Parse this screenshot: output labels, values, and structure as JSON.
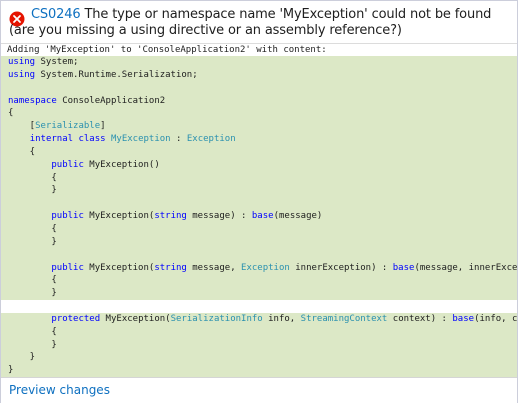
{
  "error": {
    "code": "CS0246",
    "message": " The type or namespace name 'MyException' could not be found (are you missing a using directive or an assembly reference?)"
  },
  "adding_text": "Adding 'MyException' to 'ConsoleApplication2' with content:",
  "code_lines": [
    {
      "highlight": true,
      "parts": [
        [
          "kw",
          "using"
        ],
        [
          "",
          "System;"
        ]
      ]
    },
    {
      "highlight": true,
      "parts": [
        [
          "kw",
          "using"
        ],
        [
          "",
          "System.Runtime.Serialization;"
        ]
      ]
    },
    {
      "highlight": true,
      "parts": []
    },
    {
      "highlight": true,
      "parts": [
        [
          "kw",
          "namespace"
        ],
        [
          "",
          "ConsoleApplication2"
        ]
      ]
    },
    {
      "highlight": true,
      "parts": [
        [
          "",
          "{"
        ]
      ]
    },
    {
      "highlight": true,
      "parts": [
        [
          "",
          "    ["
        ],
        [
          "ty",
          "Serializable"
        ],
        [
          "",
          "]"
        ]
      ]
    },
    {
      "highlight": true,
      "parts": [
        [
          "",
          "    "
        ],
        [
          "kw",
          "internal"
        ],
        [
          "",
          ""
        ],
        [
          "kw",
          "class"
        ],
        [
          "",
          ""
        ],
        [
          "ty",
          "MyException"
        ],
        [
          "",
          " : "
        ],
        [
          "ty",
          "Exception"
        ]
      ]
    },
    {
      "highlight": true,
      "parts": [
        [
          "",
          "    {"
        ]
      ]
    },
    {
      "highlight": true,
      "parts": [
        [
          "",
          "        "
        ],
        [
          "kw",
          "public"
        ],
        [
          "",
          "MyException()"
        ]
      ]
    },
    {
      "highlight": true,
      "parts": [
        [
          "",
          "        {"
        ]
      ]
    },
    {
      "highlight": true,
      "parts": [
        [
          "",
          "        }"
        ]
      ]
    },
    {
      "highlight": true,
      "parts": []
    },
    {
      "highlight": true,
      "parts": [
        [
          "",
          "        "
        ],
        [
          "kw",
          "public"
        ],
        [
          "",
          "MyException("
        ],
        [
          "kw",
          "string"
        ],
        [
          "",
          "message) : "
        ],
        [
          "kw",
          "base"
        ],
        [
          "",
          "(message)"
        ]
      ]
    },
    {
      "highlight": true,
      "parts": [
        [
          "",
          "        {"
        ]
      ]
    },
    {
      "highlight": true,
      "parts": [
        [
          "",
          "        }"
        ]
      ]
    },
    {
      "highlight": true,
      "parts": []
    },
    {
      "highlight": true,
      "parts": [
        [
          "",
          "        "
        ],
        [
          "kw",
          "public"
        ],
        [
          "",
          "MyException("
        ],
        [
          "kw",
          "string"
        ],
        [
          "",
          "message, "
        ],
        [
          "ty",
          "Exception"
        ],
        [
          "",
          "innerException) : "
        ],
        [
          "kw",
          "base"
        ],
        [
          "",
          "(message, innerExcep"
        ]
      ]
    },
    {
      "highlight": true,
      "parts": [
        [
          "",
          "        {"
        ]
      ]
    },
    {
      "highlight": true,
      "parts": [
        [
          "",
          "        }"
        ]
      ]
    },
    {
      "highlight": false,
      "parts": []
    },
    {
      "highlight": true,
      "parts": [
        [
          "",
          "        "
        ],
        [
          "kw",
          "protected"
        ],
        [
          "",
          "MyException("
        ],
        [
          "ty",
          "SerializationInfo"
        ],
        [
          "",
          "info, "
        ],
        [
          "ty",
          "StreamingContext"
        ],
        [
          "",
          "context) : "
        ],
        [
          "kw",
          "base"
        ],
        [
          "",
          "(info, co"
        ]
      ]
    },
    {
      "highlight": true,
      "parts": [
        [
          "",
          "        {"
        ]
      ]
    },
    {
      "highlight": true,
      "parts": [
        [
          "",
          "        }"
        ]
      ]
    },
    {
      "highlight": true,
      "parts": [
        [
          "",
          "    }"
        ]
      ]
    },
    {
      "highlight": true,
      "parts": [
        [
          "",
          "}"
        ]
      ]
    }
  ],
  "footer": {
    "preview_label": "Preview changes"
  },
  "colors": {
    "keyword": "#0000ff",
    "type": "#2b91af",
    "highlight": "#dce8c6",
    "link": "#0e70c0",
    "error": "#e51400"
  }
}
